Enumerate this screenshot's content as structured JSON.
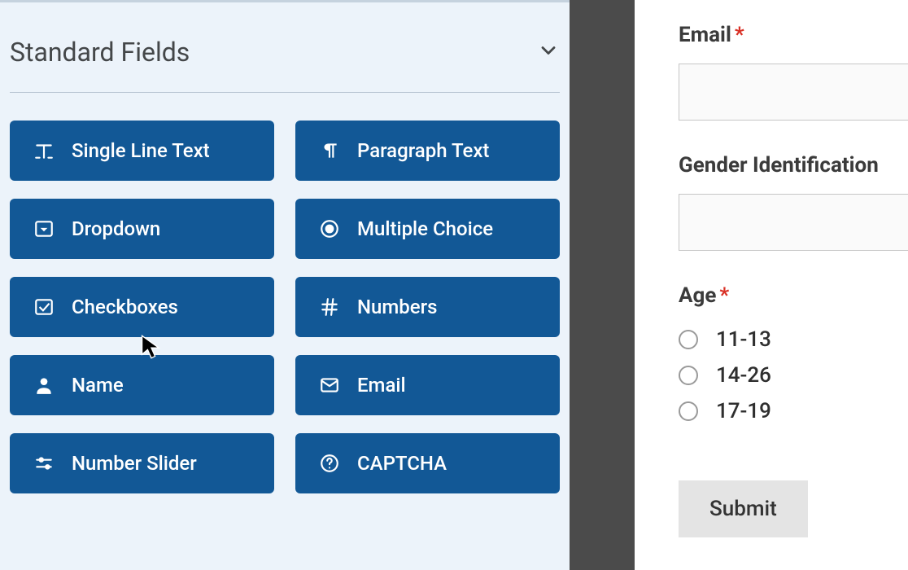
{
  "panel": {
    "section_title": "Standard Fields",
    "fields": [
      {
        "label": "Single Line Text",
        "icon": "text-icon"
      },
      {
        "label": "Paragraph Text",
        "icon": "paragraph-icon"
      },
      {
        "label": "Dropdown",
        "icon": "dropdown-icon"
      },
      {
        "label": "Multiple Choice",
        "icon": "radio-icon"
      },
      {
        "label": "Checkboxes",
        "icon": "checkbox-icon"
      },
      {
        "label": "Numbers",
        "icon": "hash-icon"
      },
      {
        "label": "Name",
        "icon": "person-icon"
      },
      {
        "label": "Email",
        "icon": "envelope-icon"
      },
      {
        "label": "Number Slider",
        "icon": "slider-icon"
      },
      {
        "label": "CAPTCHA",
        "icon": "question-icon"
      }
    ]
  },
  "preview": {
    "email": {
      "label": "Email",
      "required": true
    },
    "gender": {
      "label": "Gender Identification",
      "required": false
    },
    "age": {
      "label": "Age",
      "required": true,
      "options": [
        "11-13",
        "14-26",
        "17-19"
      ]
    },
    "submit_label": "Submit"
  }
}
